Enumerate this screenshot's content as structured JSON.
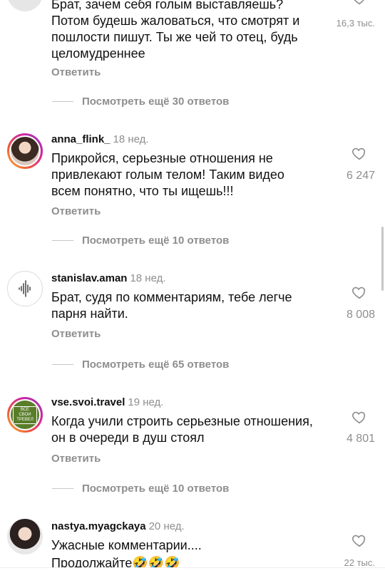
{
  "comments": [
    {
      "text": "Брат, зачем себя голым выставляешь? Потом будешь жаловаться, что смотрят и пошлости пишут. Ты же чей то отец, будь целомудреннее",
      "reply": "Ответить",
      "likes": "16,3 тыс.",
      "more_replies": "Посмотреть ещё 30 ответов"
    },
    {
      "user": "anna_flink_",
      "ago": "18 нед.",
      "text": "Прикройся, серьезные отношения не привлекают голым телом!  Таким видео всем понятно, что ты ищешь!!!",
      "reply": "Ответить",
      "likes": "6 247",
      "more_replies": "Посмотреть ещё 10 ответов"
    },
    {
      "user": "stanislav.aman",
      "ago": "18 нед.",
      "text": "Брат, судя по комментариям, тебе легче парня найти.",
      "reply": "Ответить",
      "likes": "8 008",
      "more_replies": "Посмотреть ещё 65 ответов"
    },
    {
      "user": "vse.svoi.travel",
      "ago": "19 нед.",
      "avatar_text": "ВСЕ СВОИ ТРЕВЕЛ",
      "text": "Когда учили строить серьезные отношения, он в очереди в душ стоял",
      "reply": "Ответить",
      "likes": "4 801",
      "more_replies": "Посмотреть ещё 10 ответов"
    },
    {
      "user": "nastya.myagckaya",
      "ago": "20 нед.",
      "text": "Ужасные комментарии....",
      "text2": "Продолжайте🤣🤣🤣",
      "likes": "22 тыс."
    }
  ],
  "icons": {
    "like": "heart-outline-icon"
  },
  "colors": {
    "secondary_text": "#8e8e8e",
    "story_ring": "#d6249f",
    "avatar_green": "#5a7d2a"
  }
}
